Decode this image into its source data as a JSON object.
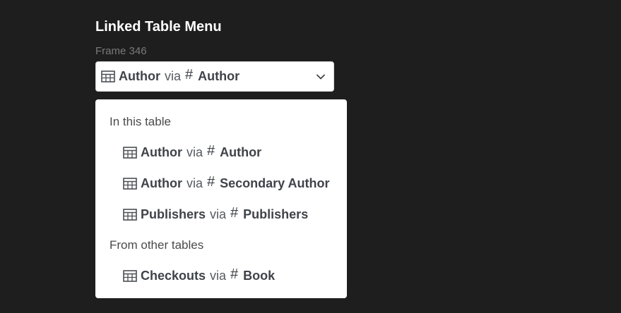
{
  "header": {
    "title": "Linked Table Menu",
    "frame_label": "Frame 346"
  },
  "select": {
    "table": "Author",
    "via": "via",
    "hash": "#",
    "column": "Author",
    "icon": "table-icon",
    "chevron": "chevron-down-icon"
  },
  "dropdown": {
    "groups": [
      {
        "heading": "In this table",
        "options": [
          {
            "table": "Author",
            "via": "via",
            "hash": "#",
            "column": "Author"
          },
          {
            "table": "Author",
            "via": "via",
            "hash": "#",
            "column": "Secondary Author"
          },
          {
            "table": "Publishers",
            "via": "via",
            "hash": "#",
            "column": "Publishers"
          }
        ]
      },
      {
        "heading": "From other tables",
        "options": [
          {
            "table": "Checkouts",
            "via": "via",
            "hash": "#",
            "column": "Book"
          }
        ]
      }
    ]
  },
  "colors": {
    "background": "#1e1e1e",
    "surface": "#ffffff",
    "text": "#3f4349",
    "muted": "#7a7a7a"
  }
}
